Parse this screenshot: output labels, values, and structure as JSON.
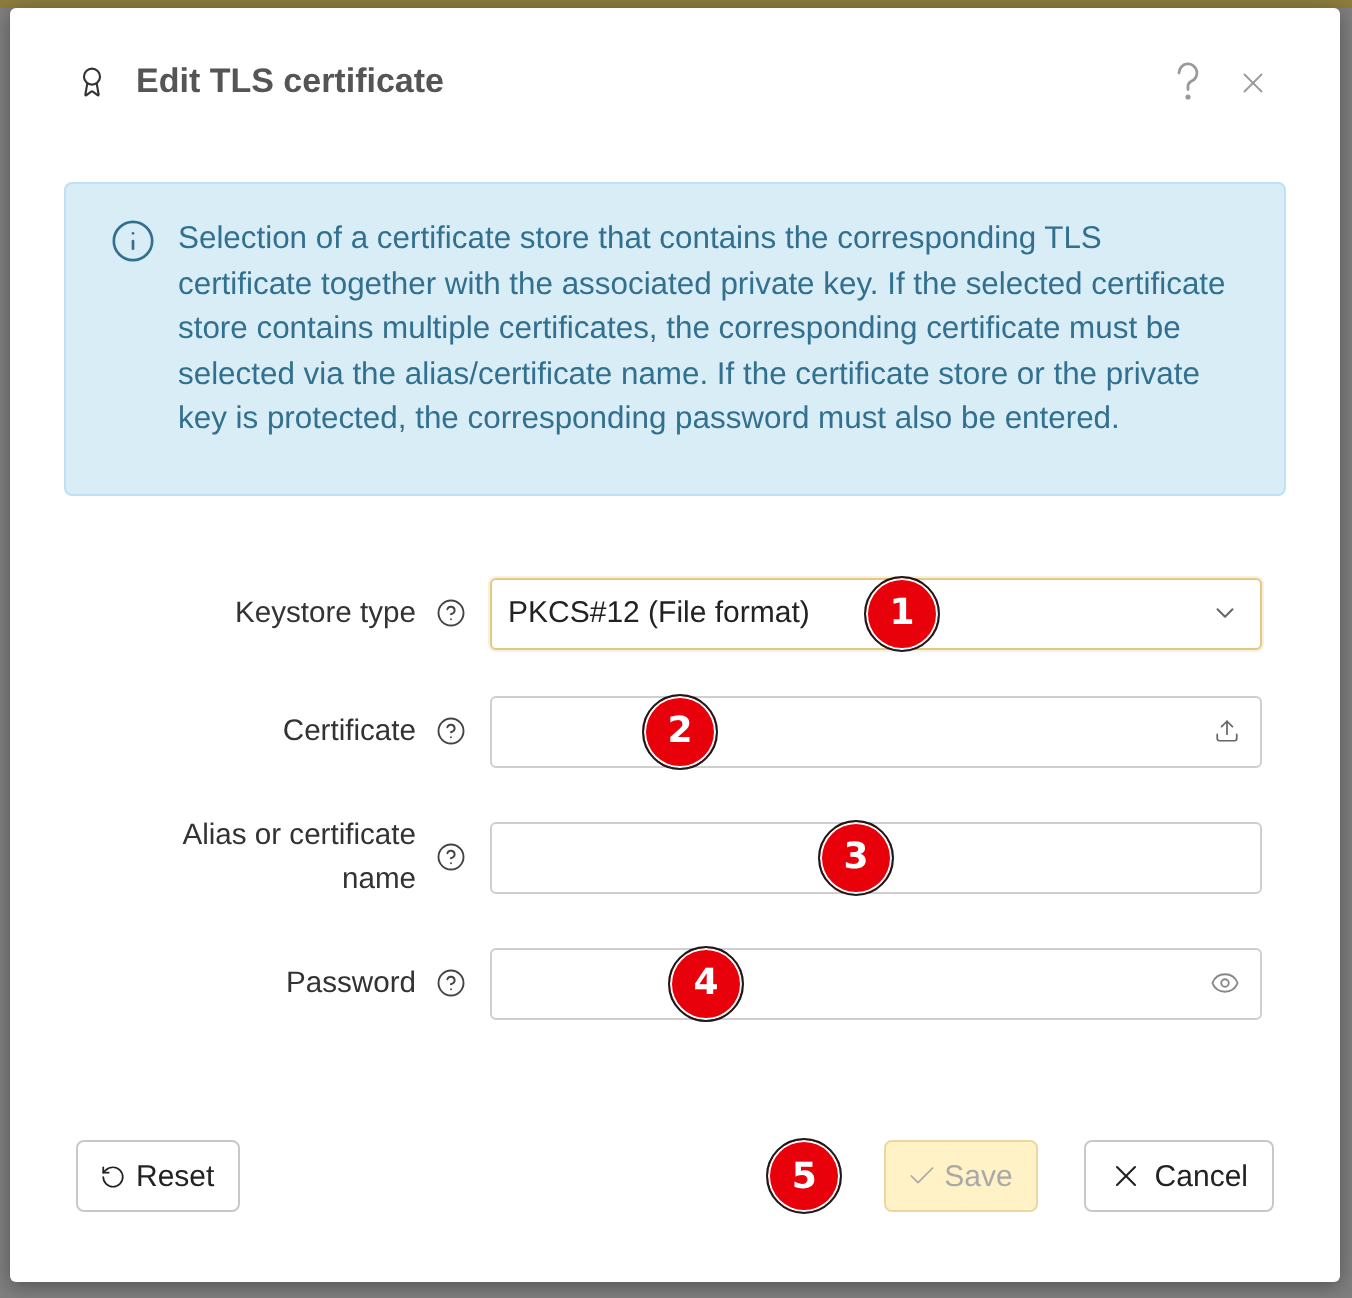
{
  "dialog": {
    "title": "Edit TLS certificate"
  },
  "info": {
    "text": "Selection of a certificate store that contains the corresponding TLS certificate together with the associated private key. If the selected certificate store contains multiple certificates, the corresponding certificate must be selected via the alias/certificate name. If the certificate store or the private key is protected, the corresponding password must also be entered."
  },
  "fields": [
    {
      "kind": "select",
      "label": "Keystore type",
      "value": "PKCS#12 (File format)",
      "focused": true,
      "marker": "1"
    },
    {
      "kind": "file",
      "label": "Certificate",
      "focused": false,
      "marker": "2"
    },
    {
      "kind": "text",
      "label": "Alias or certificate name",
      "focused": false,
      "marker": "3"
    },
    {
      "kind": "password",
      "label": "Password",
      "focused": false,
      "marker": "4"
    }
  ],
  "buttons": [
    {
      "kind": "reset",
      "label": "Reset",
      "disabled": false
    },
    {
      "kind": "save",
      "label": "Save",
      "disabled": true,
      "marker": "5"
    },
    {
      "kind": "cancel",
      "label": "Cancel",
      "disabled": false
    }
  ]
}
